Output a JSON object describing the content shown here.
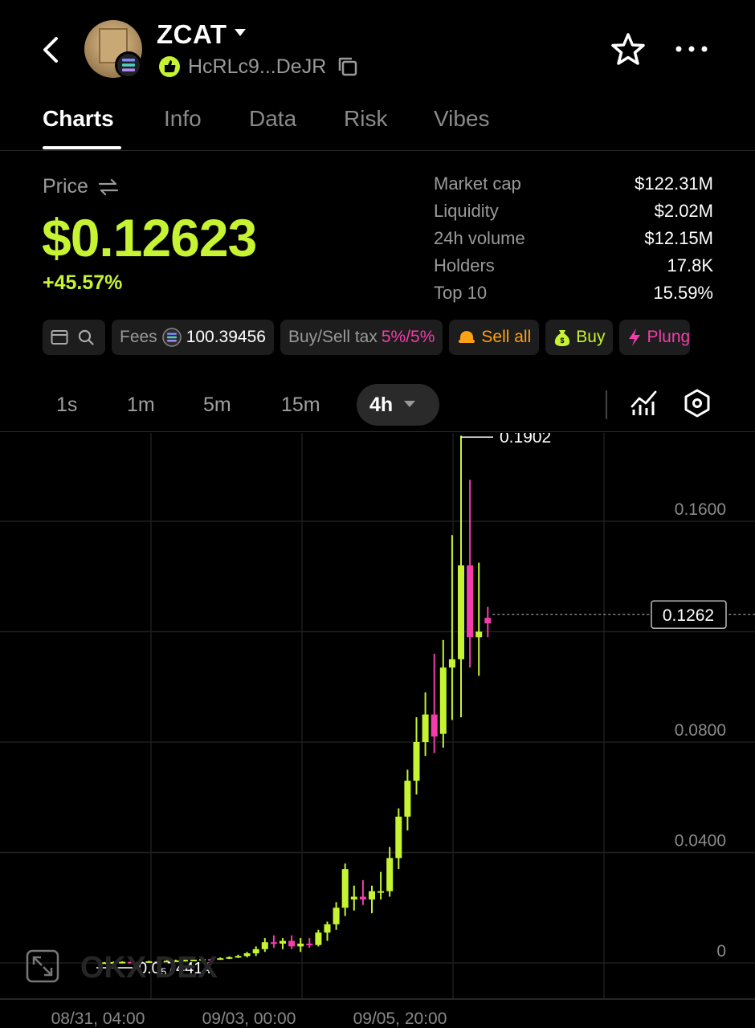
{
  "header": {
    "token_name": "ZCAT",
    "address": "HcRLc9...DeJR",
    "icons": [
      "back-icon",
      "solana-chain-icon",
      "community-badge-icon",
      "copy-icon",
      "star-icon",
      "more-icon"
    ]
  },
  "tabs": [
    {
      "label": "Charts",
      "active": true
    },
    {
      "label": "Info",
      "active": false
    },
    {
      "label": "Data",
      "active": false
    },
    {
      "label": "Risk",
      "active": false
    },
    {
      "label": "Vibes",
      "active": false
    }
  ],
  "price": {
    "label": "Price",
    "value": "$0.12623",
    "change": "+45.57%"
  },
  "stats": [
    {
      "label": "Market cap",
      "value": "$122.31M"
    },
    {
      "label": "Liquidity",
      "value": "$2.02M"
    },
    {
      "label": "24h volume",
      "value": "$12.15M"
    },
    {
      "label": "Holders",
      "value": "17.8K"
    },
    {
      "label": "Top 10",
      "value": "15.59%"
    }
  ],
  "toolbar": {
    "fees_label": "Fees",
    "fees_value": "100.39456",
    "tax_label": "Buy/Sell tax",
    "tax_value": "5%/5%",
    "sell_all": "Sell all",
    "buy": "Buy",
    "plunge": "Plung"
  },
  "intervals": {
    "options": [
      "1s",
      "1m",
      "5m",
      "15m"
    ],
    "active": "4h"
  },
  "chart": {
    "watermark": "OKX DEX",
    "last_price_label": "0.1262",
    "high_label": "0.1902",
    "low_label": "0.0₅74414",
    "colors": {
      "up": "#c6f432",
      "down": "#f23dab",
      "grid": "#1e1e1e",
      "axis_text": "#8a8a8a"
    }
  },
  "chart_data": {
    "type": "candlestick",
    "y_ticks": [
      "0.1600",
      "0.0800",
      "0.0400",
      "0"
    ],
    "y_tick_values": [
      0.16,
      0.08,
      0.04,
      0
    ],
    "x_ticks": [
      "08/31, 04:00",
      "09/03, 00:00",
      "09/05, 20:00"
    ],
    "candles": [
      {
        "o": 7.4e-06,
        "h": 0.0003,
        "l": 7.4e-06,
        "c": 0.0002
      },
      {
        "o": 0.0002,
        "h": 0.0005,
        "l": 0.0001,
        "c": 0.0003
      },
      {
        "o": 0.0003,
        "h": 0.0006,
        "l": 0.0002,
        "c": 0.0004
      },
      {
        "o": 0.0004,
        "h": 0.0006,
        "l": 0.0003,
        "c": 0.0003
      },
      {
        "o": 0.0003,
        "h": 0.0005,
        "l": 0.0002,
        "c": 0.0004
      },
      {
        "o": 0.0004,
        "h": 0.0008,
        "l": 0.0003,
        "c": 0.0006
      },
      {
        "o": 0.0006,
        "h": 0.0009,
        "l": 0.0004,
        "c": 0.0005
      },
      {
        "o": 0.0005,
        "h": 0.001,
        "l": 0.0004,
        "c": 0.0008
      },
      {
        "o": 0.0008,
        "h": 0.0012,
        "l": 0.0006,
        "c": 0.0009
      },
      {
        "o": 0.0009,
        "h": 0.0013,
        "l": 0.0007,
        "c": 0.0011
      },
      {
        "o": 0.0011,
        "h": 0.0015,
        "l": 0.0009,
        "c": 0.0012
      },
      {
        "o": 0.0012,
        "h": 0.0016,
        "l": 0.001,
        "c": 0.0014
      },
      {
        "o": 0.0014,
        "h": 0.0018,
        "l": 0.0011,
        "c": 0.0013
      },
      {
        "o": 0.0013,
        "h": 0.002,
        "l": 0.0012,
        "c": 0.0017
      },
      {
        "o": 0.0017,
        "h": 0.0024,
        "l": 0.0014,
        "c": 0.0021
      },
      {
        "o": 0.0021,
        "h": 0.003,
        "l": 0.0018,
        "c": 0.0025
      },
      {
        "o": 0.0025,
        "h": 0.004,
        "l": 0.002,
        "c": 0.0035
      },
      {
        "o": 0.0035,
        "h": 0.006,
        "l": 0.0025,
        "c": 0.005
      },
      {
        "o": 0.005,
        "h": 0.009,
        "l": 0.004,
        "c": 0.0075
      },
      {
        "o": 0.0075,
        "h": 0.01,
        "l": 0.0055,
        "c": 0.007
      },
      {
        "o": 0.007,
        "h": 0.009,
        "l": 0.005,
        "c": 0.008
      },
      {
        "o": 0.008,
        "h": 0.01,
        "l": 0.005,
        "c": 0.006
      },
      {
        "o": 0.006,
        "h": 0.009,
        "l": 0.004,
        "c": 0.007
      },
      {
        "o": 0.007,
        "h": 0.009,
        "l": 0.0055,
        "c": 0.0065
      },
      {
        "o": 0.0065,
        "h": 0.012,
        "l": 0.006,
        "c": 0.011
      },
      {
        "o": 0.011,
        "h": 0.015,
        "l": 0.008,
        "c": 0.014
      },
      {
        "o": 0.014,
        "h": 0.022,
        "l": 0.012,
        "c": 0.02
      },
      {
        "o": 0.02,
        "h": 0.036,
        "l": 0.017,
        "c": 0.034
      },
      {
        "o": 0.023,
        "h": 0.028,
        "l": 0.019,
        "c": 0.024
      },
      {
        "o": 0.024,
        "h": 0.03,
        "l": 0.021,
        "c": 0.023
      },
      {
        "o": 0.023,
        "h": 0.028,
        "l": 0.018,
        "c": 0.026
      },
      {
        "o": 0.026,
        "h": 0.033,
        "l": 0.023,
        "c": 0.026
      },
      {
        "o": 0.026,
        "h": 0.042,
        "l": 0.024,
        "c": 0.038
      },
      {
        "o": 0.038,
        "h": 0.056,
        "l": 0.034,
        "c": 0.053
      },
      {
        "o": 0.053,
        "h": 0.07,
        "l": 0.048,
        "c": 0.066
      },
      {
        "o": 0.066,
        "h": 0.089,
        "l": 0.061,
        "c": 0.08
      },
      {
        "o": 0.08,
        "h": 0.098,
        "l": 0.075,
        "c": 0.09
      },
      {
        "o": 0.09,
        "h": 0.112,
        "l": 0.076,
        "c": 0.082
      },
      {
        "o": 0.083,
        "h": 0.117,
        "l": 0.078,
        "c": 0.107
      },
      {
        "o": 0.107,
        "h": 0.155,
        "l": 0.088,
        "c": 0.11
      },
      {
        "o": 0.11,
        "h": 0.191,
        "l": 0.089,
        "c": 0.144
      },
      {
        "o": 0.144,
        "h": 0.175,
        "l": 0.107,
        "c": 0.118
      },
      {
        "o": 0.118,
        "h": 0.145,
        "l": 0.104,
        "c": 0.12
      },
      {
        "o": 0.125,
        "h": 0.129,
        "l": 0.118,
        "c": 0.123
      }
    ],
    "ylim": [
      0,
      0.2
    ]
  }
}
